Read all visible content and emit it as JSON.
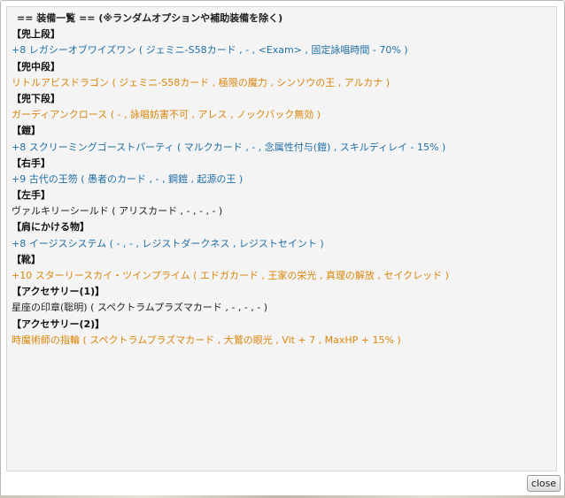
{
  "title": "== 装備一覧 == (※ランダムオプションや補助装備を除く)",
  "close_label": "close",
  "sections": [
    {
      "heading": "【兜上段】",
      "item": "+8 レガシーオブワイズワン ( ジェミニ-S58カード , - , <Exam> , 固定詠唱時間 - 70% )",
      "color": "blue"
    },
    {
      "heading": "【兜中段】",
      "item": "リトルアビスドラゴン ( ジェミニ-S58カード , 極限の魔力 , シンソウの王 , アルカナ )",
      "color": "orange"
    },
    {
      "heading": "【兜下段】",
      "item": "ガーディアンクロース ( - , 詠唱妨害不可 , アレス , ノックバック無効 )",
      "color": "orange"
    },
    {
      "heading": "【鎧】",
      "item": "+8 スクリーミングゴーストパーティ ( マルクカード , - , 念属性付与(鎧) , スキルディレイ - 15% )",
      "color": "blue"
    },
    {
      "heading": "【右手】",
      "item": "+9 古代の王笏 ( 愚者のカード , - , 鋼鎧 , 起源の王 )",
      "color": "blue"
    },
    {
      "heading": "【左手】",
      "item": "ヴァルキリーシールド ( アリスカード , - , - , - )",
      "color": "black"
    },
    {
      "heading": "【肩にかける物】",
      "item": "+8 イージスシステム ( - , - , レジストダークネス , レジストセイント )",
      "color": "blue"
    },
    {
      "heading": "【靴】",
      "item": "+10 スターリースカイ・ツインプライム ( エドガカード , 王家の栄光 , 真理の解放 , セイクレッド )",
      "color": "orange"
    },
    {
      "heading": "【アクセサリー(1)】",
      "item": "星座の印章(聡明) ( スペクトラムプラズマカード , - , - , - )",
      "color": "black"
    },
    {
      "heading": "【アクセサリー(2)】",
      "item": "時魔術師の指輪 ( スペクトラムプラズマカード , 大鷲の眼光 , Vit + 7 , MaxHP + 15% )",
      "color": "orange"
    }
  ],
  "colors": {
    "blue": "#1f6ea5",
    "orange": "#d9860c",
    "black": "#222222"
  }
}
